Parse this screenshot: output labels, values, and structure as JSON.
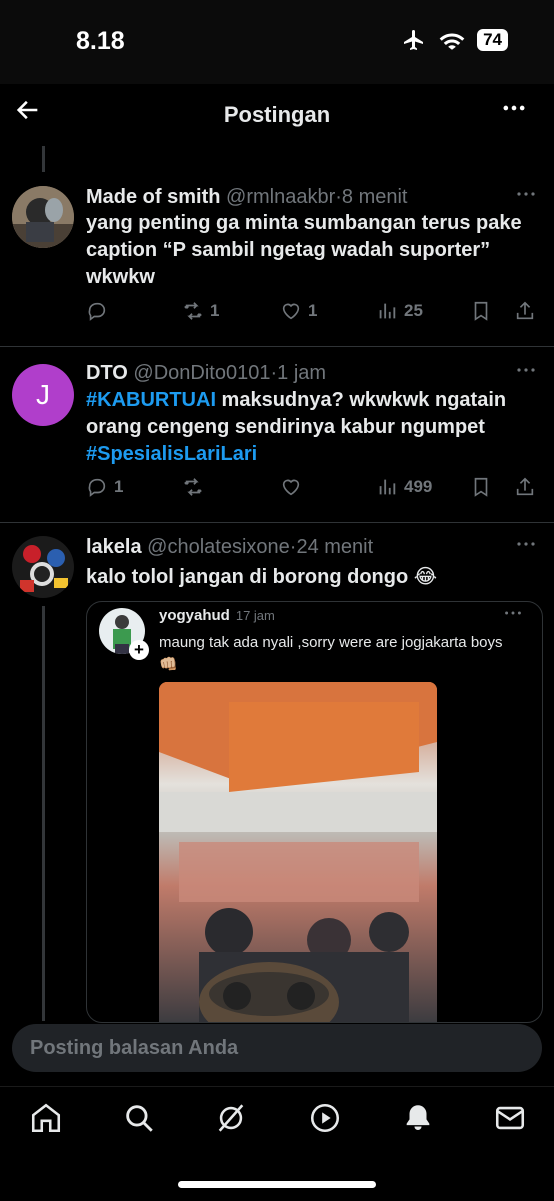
{
  "status": {
    "time": "8.18",
    "battery": "74"
  },
  "header": {
    "title": "Postingan"
  },
  "posts": [
    {
      "name": "Made of smith",
      "handle": "@rmlnaakbr",
      "sep": "·",
      "age": "8 menit",
      "text": "yang penting ga minta sumbangan terus pake caption “P sambil ngetag wadah suporter” wkwkw",
      "retweets": "1",
      "likes": "1",
      "views": "25"
    },
    {
      "name": "DTO",
      "handle": "@DonDito0101",
      "sep": "·",
      "age": "1 jam",
      "avatar_letter": "J",
      "avatar_color": "#b03ecb",
      "hashtag1": "#KABURTUAI",
      "text_mid": " maksudnya? wkwkwk ngatain orang cengeng sendirinya kabur ngumpet ",
      "hashtag2": "#SpesialisLariLari",
      "replies": "1",
      "views": "499"
    },
    {
      "name": "lakela",
      "handle": "@cholatesixone",
      "sep": "·",
      "age": "24 menit",
      "text": "kalo tolol jangan di borong dongo 😂",
      "quote": {
        "name": "yogyahud",
        "age": "17 jam",
        "text": "maung tak ada nyali ,sorry were are jogjakarta boys",
        "emoji": "👊🏼"
      }
    }
  ],
  "reply_placeholder": "Posting balasan Anda",
  "colors": {
    "link": "#1d9bf0",
    "muted": "#71767b",
    "text": "#e7e9ea"
  },
  "icons": [
    "back-arrow-icon",
    "more-icon",
    "reply-icon",
    "retweet-icon",
    "like-icon",
    "views-icon",
    "bookmark-icon",
    "share-icon",
    "home-icon",
    "search-icon",
    "grok-icon",
    "video-icon",
    "notifications-icon",
    "messages-icon"
  ]
}
